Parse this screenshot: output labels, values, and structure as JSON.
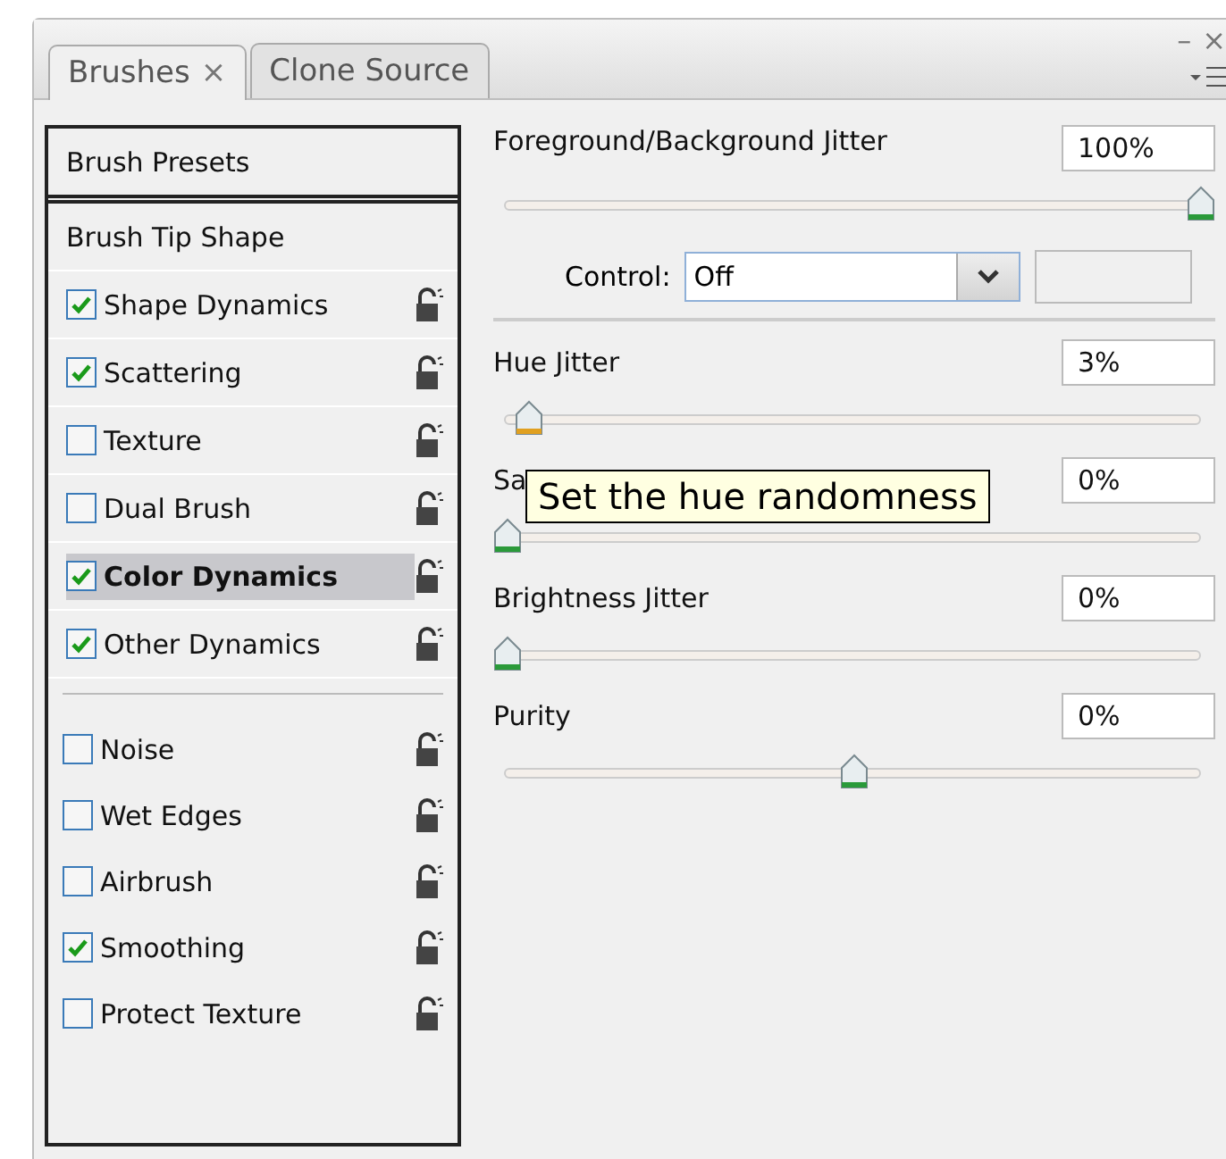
{
  "window": {
    "minimize": "–",
    "close": "×"
  },
  "tabs": [
    {
      "label": "Brushes",
      "selected": true,
      "close": "×"
    },
    {
      "label": "Clone Source",
      "selected": false
    }
  ],
  "sidebar": {
    "sections": [
      {
        "items": [
          {
            "kind": "preset",
            "label": "Brush Presets",
            "selected": false
          }
        ]
      },
      {
        "items": [
          {
            "kind": "plain",
            "label": "Brush Tip Shape",
            "selected": false
          },
          {
            "kind": "checkbox",
            "label": "Shape Dynamics",
            "checked": true,
            "selected": false
          },
          {
            "kind": "checkbox",
            "label": "Scattering",
            "checked": true,
            "selected": false
          },
          {
            "kind": "checkbox",
            "label": "Texture",
            "checked": false,
            "selected": false
          },
          {
            "kind": "checkbox",
            "label": "Dual Brush",
            "checked": false,
            "selected": false
          },
          {
            "kind": "checkbox",
            "label": "Color Dynamics",
            "checked": true,
            "selected": true
          },
          {
            "kind": "checkbox",
            "label": "Other Dynamics",
            "checked": true,
            "selected": false
          }
        ]
      },
      {
        "items": [
          {
            "kind": "checkbox",
            "label": "Noise",
            "checked": false,
            "selected": false
          },
          {
            "kind": "checkbox",
            "label": "Wet Edges",
            "checked": false,
            "selected": false
          },
          {
            "kind": "checkbox",
            "label": "Airbrush",
            "checked": false,
            "selected": false
          },
          {
            "kind": "checkbox",
            "label": "Smoothing",
            "checked": true,
            "selected": false
          },
          {
            "kind": "checkbox",
            "label": "Protect Texture",
            "checked": false,
            "selected": false
          }
        ]
      }
    ]
  },
  "settings": [
    {
      "kind": "slider",
      "label": "Foreground/Background Jitter",
      "value": "100%",
      "level": 1,
      "active": false
    },
    {
      "kind": "control",
      "label": "Control:",
      "value": "Off"
    },
    {
      "kind": "slider",
      "label": "Hue Jitter",
      "value": "3%",
      "level": 0.03,
      "active": true
    },
    {
      "kind": "slider",
      "label": "Sa",
      "value": "0%",
      "level": 0,
      "active": false
    },
    {
      "kind": "slider",
      "label": "Brightness Jitter",
      "value": "0%",
      "level": 0,
      "active": false
    },
    {
      "kind": "slider",
      "label": "Purity",
      "value": "0%",
      "level": 0.5,
      "active": false
    }
  ],
  "tooltip": {
    "text": "Set the hue randomness"
  }
}
